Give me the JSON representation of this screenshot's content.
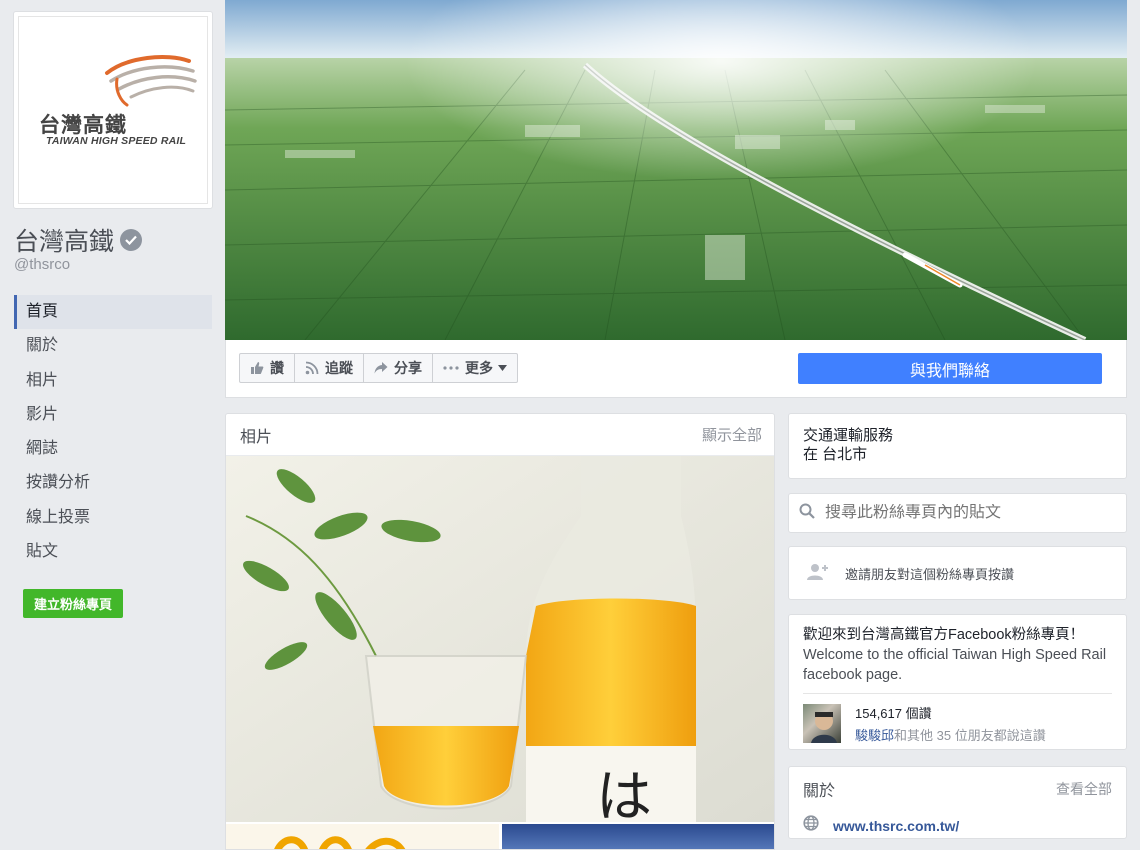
{
  "page": {
    "name": "台灣高鐵",
    "handle": "@thsrco",
    "logo_cn": "台灣高鐵",
    "logo_en": "TAIWAN HIGH SPEED RAIL"
  },
  "nav": {
    "items": [
      {
        "label": "首頁",
        "active": true
      },
      {
        "label": "關於"
      },
      {
        "label": "相片"
      },
      {
        "label": "影片"
      },
      {
        "label": "網誌"
      },
      {
        "label": "按讚分析"
      },
      {
        "label": "線上投票"
      },
      {
        "label": "貼文"
      }
    ],
    "create_page": "建立粉絲專頁"
  },
  "actions": {
    "like": "讚",
    "follow": "追蹤",
    "share": "分享",
    "more": "更多",
    "contact": "與我們聯絡"
  },
  "photos": {
    "title": "相片",
    "see_all": "顯示全部"
  },
  "category": {
    "line1": "交通運輸服務",
    "line2": "在 台北市"
  },
  "search": {
    "placeholder": "搜尋此粉絲專頁內的貼文"
  },
  "invite": {
    "label": "邀請朋友對這個粉絲專頁按讚"
  },
  "welcome": {
    "zh": "歡迎來到台灣高鐵官方Facebook粉絲專頁！",
    "en": "Welcome to the official Taiwan High Speed Rail facebook page.",
    "likes_count": "154,617 個讚",
    "friend_name": "駿駿邱",
    "friends_text": "和其他 35 位朋友都說這讚"
  },
  "about": {
    "title": "關於",
    "see_all": "查看全部",
    "website": "www.thsrc.com.tw/"
  },
  "colors": {
    "accent": "#4267b2",
    "contact_button": "#4080ff",
    "create_button": "#42b72a",
    "link": "#365899"
  }
}
